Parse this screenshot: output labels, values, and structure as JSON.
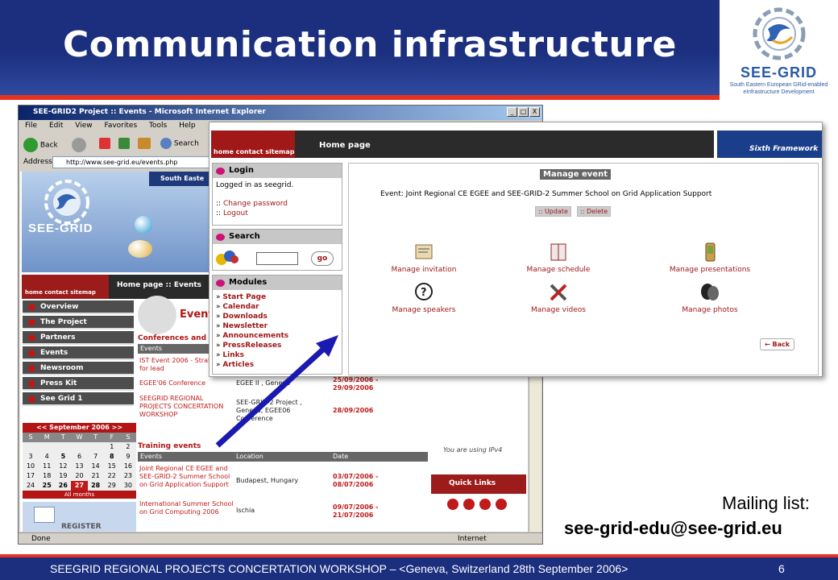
{
  "slide": {
    "title": "Communication infrastructure",
    "logo_word": "SEE-GRID",
    "logo_sub": "South Eastern European GRid-enabled eInfrastructure Development",
    "footer": "SEEGRID REGIONAL PROJECTS CONCERTATION WORKSHOP – <Geneva, Switzerland 28th September 2006>",
    "page_number": "6",
    "mailing_label": "Mailing list:",
    "mailing_address": "see-grid-edu@see-grid.eu",
    "accent": "#e6321e",
    "navy": "#1b2f7e"
  },
  "browser": {
    "title": "SEE-GRID2 Project :: Events - Microsoft Internet Explorer",
    "menu": [
      "File",
      "Edit",
      "View",
      "Favorites",
      "Tools",
      "Help"
    ],
    "back_label": "Back",
    "search_label": "Search",
    "address_label": "Address",
    "url": "http://www.see-grid.eu/events.php",
    "status": "Done",
    "zone": "Internet",
    "window_buttons": [
      "_",
      "□",
      "X"
    ]
  },
  "site": {
    "top_strip": "South Easte",
    "nav_links": "home contact sitemap",
    "breadcrumb": "Home page :: Events",
    "left_nav": [
      "Overview",
      "The Project",
      "Partners",
      "Events",
      "Newsroom",
      "Press Kit",
      "See Grid 1"
    ],
    "calendar_header": "<< September 2006 >>",
    "calendar_days": [
      "S",
      "M",
      "T",
      "W",
      "T",
      "F",
      "S"
    ],
    "calendar_rows": [
      [
        "",
        "",
        "",
        "",
        "",
        "1",
        "2"
      ],
      [
        "3",
        "4",
        "5",
        "6",
        "7",
        "8",
        "9"
      ],
      [
        "10",
        "11",
        "12",
        "13",
        "14",
        "15",
        "16"
      ],
      [
        "17",
        "18",
        "19",
        "20",
        "21",
        "22",
        "23"
      ],
      [
        "24",
        "25",
        "26",
        "27",
        "28",
        "29",
        "30"
      ]
    ],
    "calendar_footer": "All months",
    "register": "REGISTER",
    "events_heading": "Event",
    "conferences_heading": "Conferences and",
    "conf_col": "Events",
    "conferences": [
      {
        "event": "IST Event 2006 - Strategies for lead",
        "location": "",
        "date": ""
      },
      {
        "event": "EGEE'06 Conference",
        "location": "EGEE II , Geneva",
        "date": "25/09/2006 - 29/09/2006"
      },
      {
        "event": "SEEGRID REGIONAL PROJECTS CONCERTATION WORKSHOP",
        "location": "SEE-GRID-2 Project , Geneva, EGEE06 Conference",
        "date": "28/09/2006"
      }
    ],
    "training_heading": "Training events",
    "training_cols": [
      "Events",
      "Location",
      "Date"
    ],
    "training": [
      {
        "event": "Joint Regional CE EGEE and SEE-GRID-2 Summer School on Grid Application Support",
        "location": "Budapest, Hungary",
        "date": "03/07/2006 - 08/07/2006"
      },
      {
        "event": "International Summer School on Grid Computing 2006",
        "location": "Ischia",
        "date": "09/07/2006 - 21/07/2006"
      }
    ],
    "ipv4": "You are using IPv4",
    "quick_links": "Quick Links"
  },
  "admin": {
    "nav_links": "home contact sitemap",
    "breadcrumb": "Home page",
    "framework": "Sixth Framework",
    "login_title": "Login",
    "logged_in": "Logged in as seegrid.",
    "change_password": "Change password",
    "logout": "Logout",
    "search_title": "Search",
    "go": "go",
    "modules_title": "Modules",
    "modules": [
      "Start Page",
      "Calendar",
      "Downloads",
      "Newsletter",
      "Announcements",
      "PressReleases",
      "Links",
      "Articles"
    ],
    "manage_title": "Manage event",
    "event_line": "Event: Joint Regional CE EGEE and SEE-GRID-2 Summer School on Grid Application Support",
    "update": "Update",
    "delete": "Delete",
    "actions": [
      "Manage invitation",
      "Manage schedule",
      "Manage presentations",
      "Manage speakers",
      "Manage videos",
      "Manage photos"
    ],
    "back": "Back"
  }
}
